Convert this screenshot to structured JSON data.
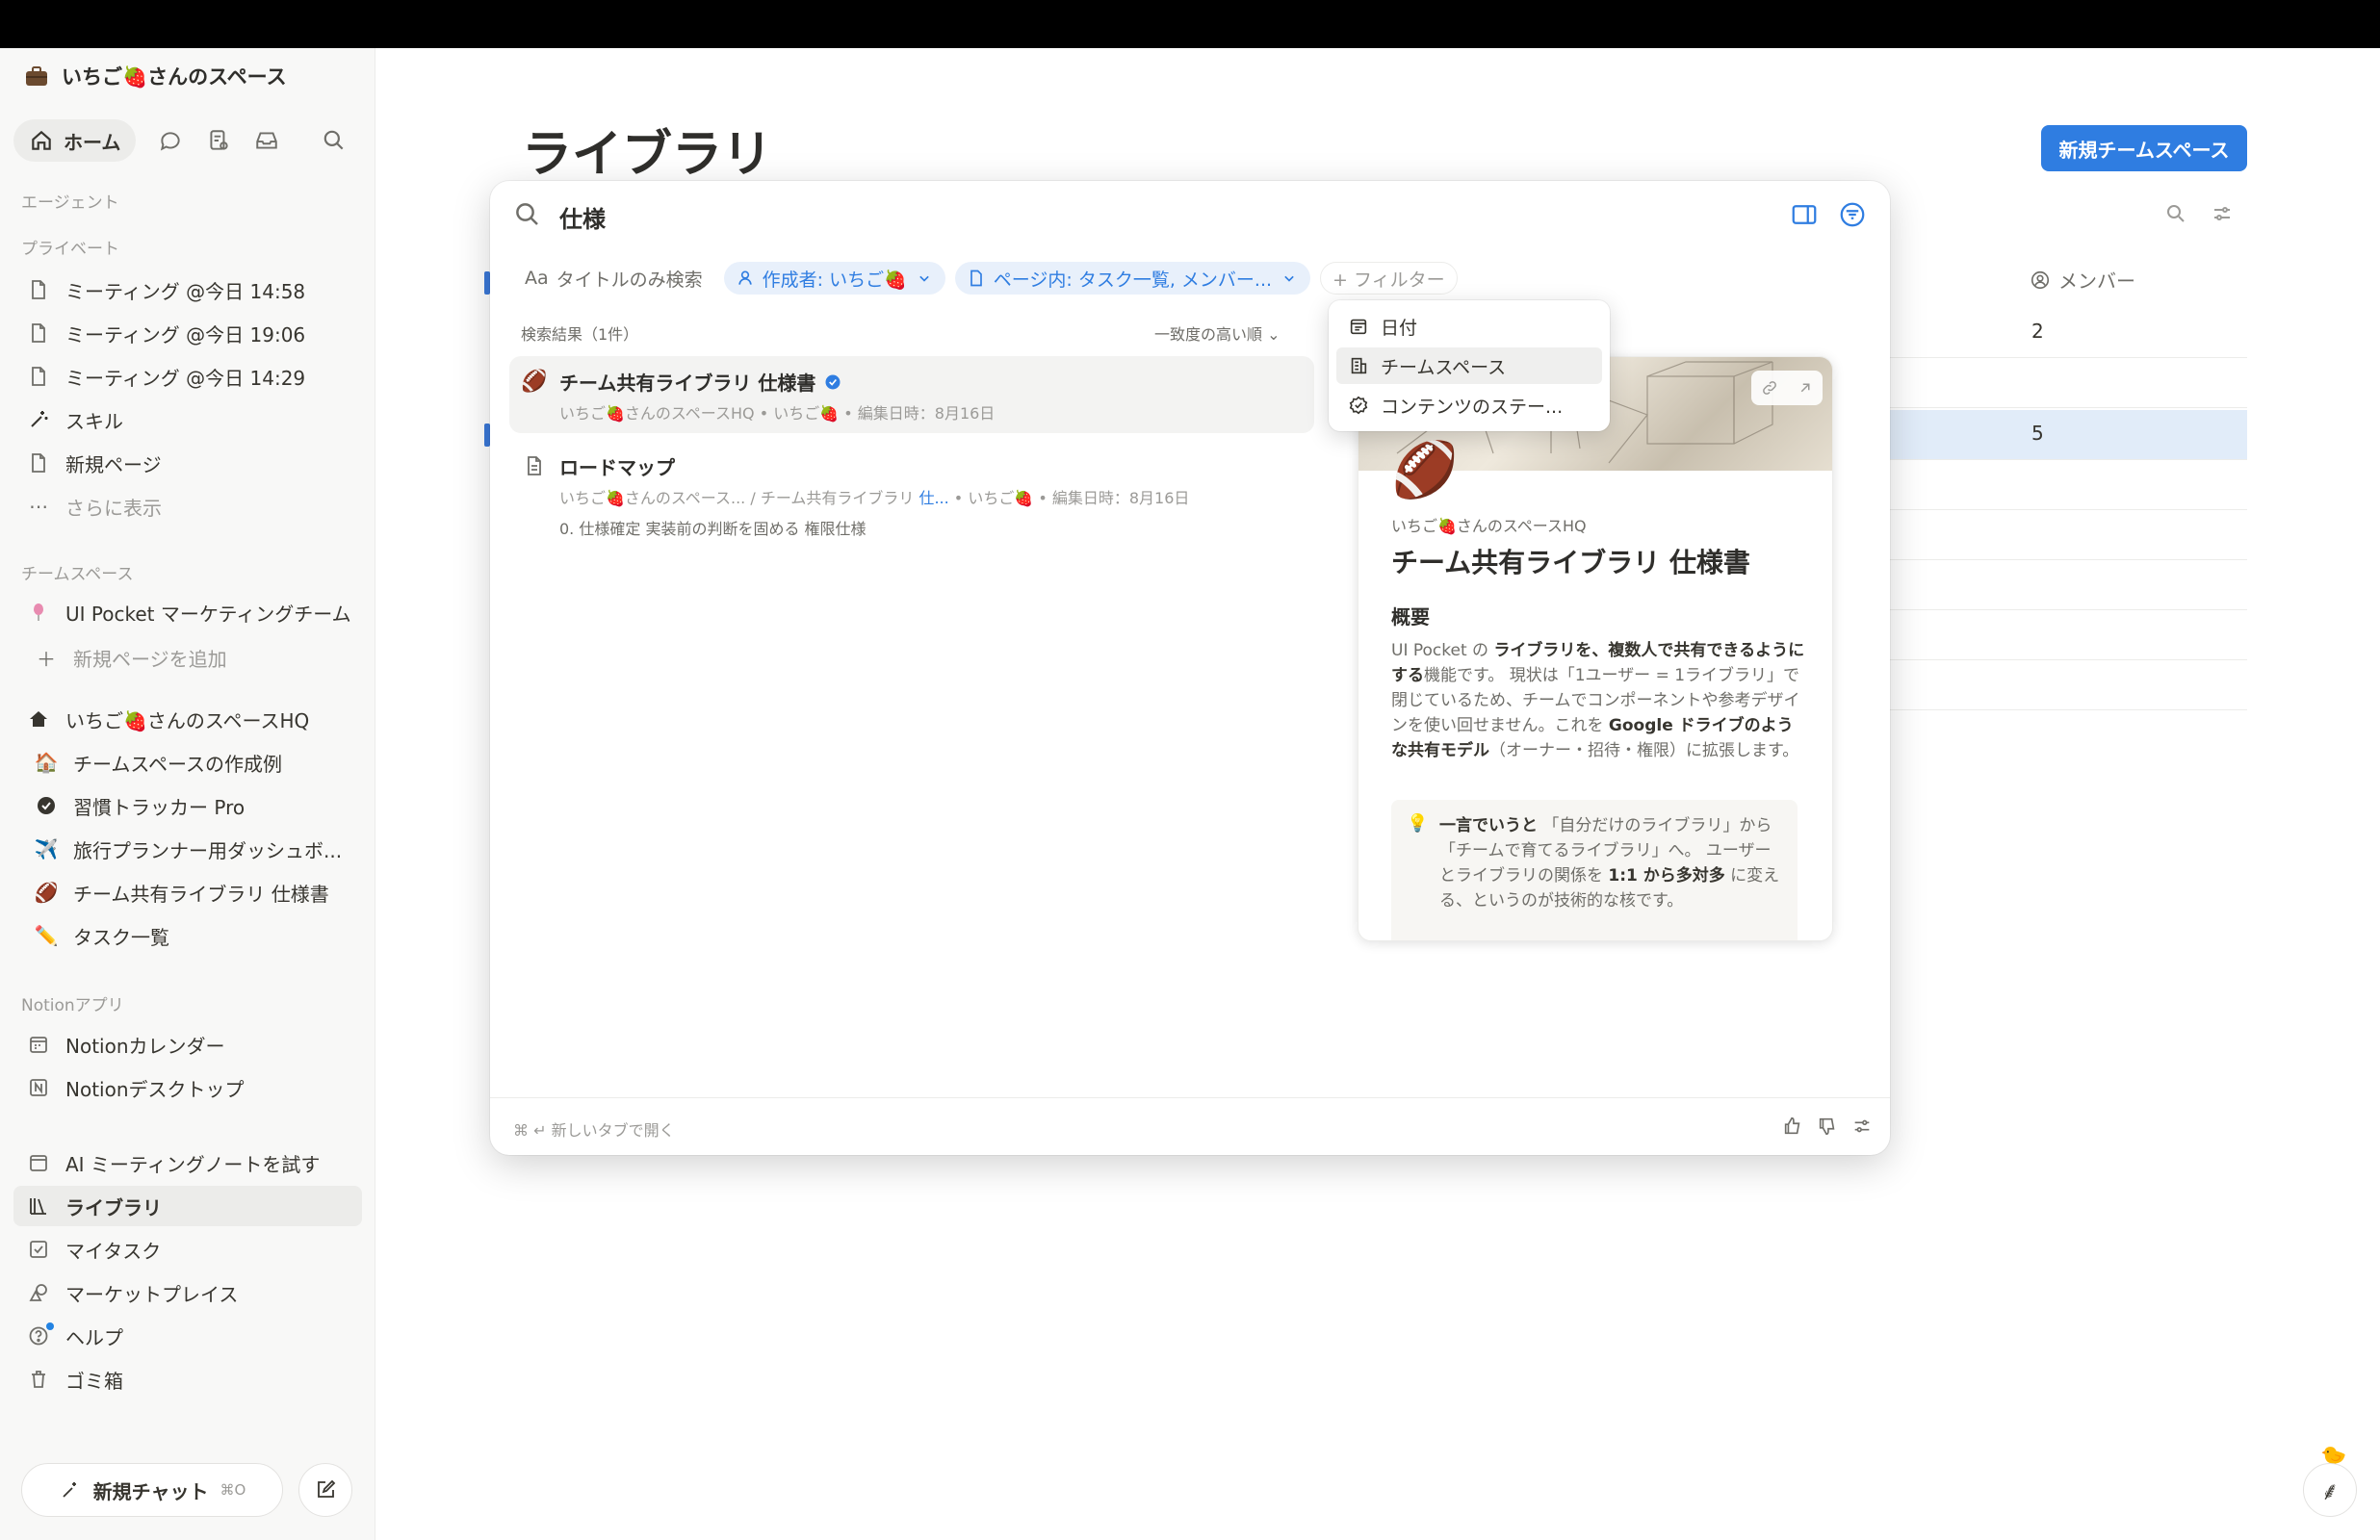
{
  "sidebar": {
    "workspace_name": "いちご🍓さんのスペース",
    "home_label": "ホーム",
    "sections": {
      "agents": "エージェント",
      "private": "プライベート",
      "teamspaces": "チームスペース",
      "notion_apps": "Notionアプリ"
    },
    "private_items": [
      {
        "label": "ミーティング @今日 14:58",
        "icon": "page-icon"
      },
      {
        "label": "ミーティング @今日 19:06",
        "icon": "page-icon"
      },
      {
        "label": "ミーティング @今日 14:29",
        "icon": "page-icon"
      },
      {
        "label": "スキル",
        "icon": "sparkle-wand-icon"
      },
      {
        "label": "新規ページ",
        "icon": "page-icon"
      },
      {
        "label": "さらに表示",
        "icon": "more-icon"
      }
    ],
    "team_items": [
      {
        "label": "UI Pocket マーケティングチーム",
        "icon": "balloon-icon"
      },
      {
        "label": "新規ページを追加",
        "icon": "plus-icon"
      }
    ],
    "hq": {
      "label": "いちご🍓さんのスペースHQ",
      "children": [
        {
          "label": "チームスペースの作成例",
          "emoji": "🏠"
        },
        {
          "label": "習慣トラッカー Pro",
          "emoji": "✔"
        },
        {
          "label": "旅行プランナー用ダッシュボ...",
          "emoji": "✈️"
        },
        {
          "label": "チーム共有ライブラリ 仕様書",
          "emoji": "🏈"
        },
        {
          "label": "タスク一覧",
          "emoji": "✏️"
        }
      ]
    },
    "apps": [
      {
        "label": "Notionカレンダー",
        "icon": "calendar-app-icon"
      },
      {
        "label": "Notionデスクトップ",
        "icon": "notion-app-icon"
      }
    ],
    "bottom": [
      {
        "label": "AI ミーティングノートを試す",
        "icon": "calendar-icon"
      },
      {
        "label": "ライブラリ",
        "icon": "library-icon"
      },
      {
        "label": "マイタスク",
        "icon": "checkbox-icon"
      },
      {
        "label": "マーケットプレイス",
        "icon": "shapes-icon"
      },
      {
        "label": "ヘルプ",
        "icon": "help-icon"
      },
      {
        "label": "ゴミ箱",
        "icon": "trash-icon"
      }
    ],
    "new_chat": {
      "label": "新規チャット",
      "shortcut": "⌘O"
    }
  },
  "main": {
    "title": "ライブラリ",
    "new_team_button": "新規チームスペース",
    "member_column": "メンバー",
    "rows": [
      {
        "value": "2"
      },
      {
        "value": ""
      },
      {
        "value": "5"
      }
    ]
  },
  "search": {
    "query": "仕様",
    "filters": {
      "title_only": "タイトルのみ検索",
      "author": "作成者: いちご🍓",
      "in_page": "ページ内: タスク一覧, メンバー...",
      "add_filter": "+ フィルター"
    },
    "results_header": "検索結果（1件）",
    "sort_label": "一致度の高い順",
    "results": [
      {
        "title": "チーム共有ライブラリ 仕様書",
        "meta": "いちご🍓さんのスペースHQ • いちご🍓 • 編集日時：8月16日"
      },
      {
        "title": "ロードマップ",
        "meta_prefix": "いちご🍓さんのスペース... / チーム共有ライブラリ ",
        "meta_link": "仕...",
        "meta_suffix": "  • いちご🍓 • 編集日時：8月16日",
        "snippet": "0. 仕様確定 実装前の判断を固める 権限仕様"
      }
    ],
    "footer_hint": "⌘ ↵  新しいタブで開く"
  },
  "filter_menu": {
    "items": [
      "日付",
      "チームスペース",
      "コンテンツのステー..."
    ]
  },
  "preview": {
    "emoji": "🏈",
    "space": "いちご🍓さんのスペースHQ",
    "title": "チーム共有ライブラリ 仕様書",
    "heading": "概要",
    "body_1": "UI Pocket の ",
    "body_bold_1": "ライブラリを、複数人で共有できるようにする",
    "body_2": "機能です。 現状は「1ユーザー = 1ライブラリ」で閉じているため、チームでコンポーネントや参考デザインを使い回せません。これを ",
    "body_bold_2": "Google ドライブのような共有モデル",
    "body_3": "（オーナー・招待・権限）に拡張します。",
    "callout_bold_1": "一言でいうと",
    "callout_1": " 「自分だけのライブラリ」から「チームで育てるライブラリ」へ。 ユーザーとライブラリの関係を ",
    "callout_bold_2": "1:1 から多対多",
    "callout_2": " に変える、というのが技術的な核です。"
  },
  "colors": {
    "accent": "#2f7de1",
    "sidebar_bg": "#f8f8f7",
    "highlight_row": "#e1ecf9"
  }
}
